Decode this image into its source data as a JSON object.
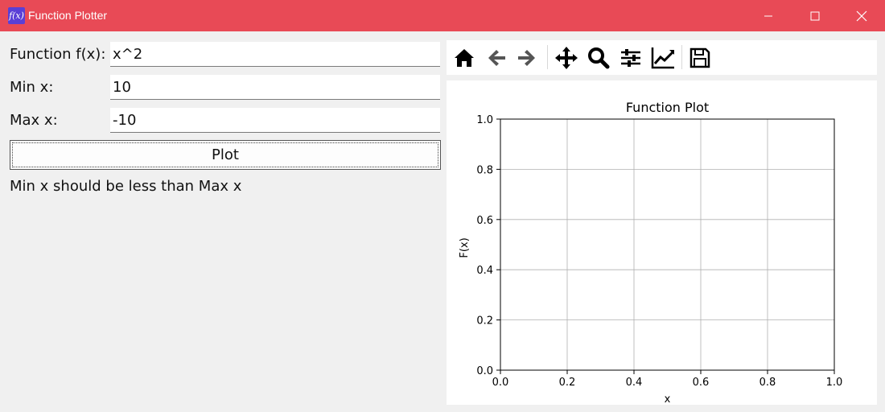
{
  "window": {
    "title": "Function Plotter",
    "icon_text": "f(x)",
    "titlebar_color": "#e84a56"
  },
  "form": {
    "function_label": "Function f(x):",
    "function_value": "x^2",
    "min_label": "Min x:",
    "min_value": "10",
    "max_label": "Max x:",
    "max_value": "-10",
    "plot_button_label": "Plot",
    "message": "Min x should be less than Max x"
  },
  "toolbar": {
    "icons": [
      "home-icon",
      "back-arrow-icon",
      "forward-arrow-icon",
      "pan-move-icon",
      "zoom-magnifier-icon",
      "configure-subplots-icon",
      "edit-axis-icon",
      "save-floppy-icon"
    ]
  },
  "chart_data": {
    "type": "line",
    "title": "Function Plot",
    "xlabel": "x",
    "ylabel": "F(x)",
    "xlim": [
      0.0,
      1.0
    ],
    "ylim": [
      0.0,
      1.0
    ],
    "xticks": [
      "0.0",
      "0.2",
      "0.4",
      "0.6",
      "0.8",
      "1.0"
    ],
    "yticks": [
      "0.0",
      "0.2",
      "0.4",
      "0.6",
      "0.8",
      "1.0"
    ],
    "grid": true,
    "series": []
  }
}
